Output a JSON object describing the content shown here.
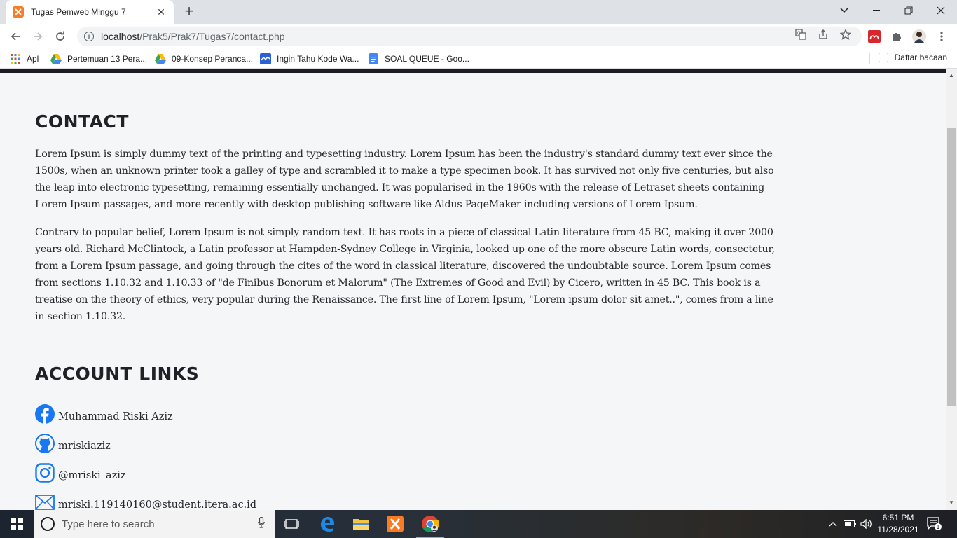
{
  "browser": {
    "tab_title": "Tugas Pemweb Minggu 7",
    "tab_close": "✕",
    "new_tab": "+",
    "url_host": "localhost",
    "url_path": "/Prak5/Prak7/Tugas7/contact.php",
    "bookmarks": [
      {
        "label": "Apl",
        "icon": "apps-grid-icon"
      },
      {
        "label": "Pertemuan 13 Pera...",
        "icon": "google-drive-icon"
      },
      {
        "label": "09-Konsep Peranca...",
        "icon": "google-drive-icon"
      },
      {
        "label": "Ingin Tahu Kode Wa...",
        "icon": "site-icon"
      },
      {
        "label": "SOAL QUEUE - Goo...",
        "icon": "google-docs-icon"
      }
    ],
    "reading_list": "Daftar bacaan"
  },
  "page": {
    "contact_heading": "CONTACT",
    "paragraph_1": "Lorem Ipsum is simply dummy text of the printing and typesetting industry. Lorem Ipsum has been the industry's standard dummy text ever since the 1500s, when an unknown printer took a galley of type and scrambled it to make a type specimen book. It has survived not only five centuries, but also the leap into electronic typesetting, remaining essentially unchanged. It was popularised in the 1960s with the release of Letraset sheets containing Lorem Ipsum passages, and more recently with desktop publishing software like Aldus PageMaker including versions of Lorem Ipsum.",
    "paragraph_2": "Contrary to popular belief, Lorem Ipsum is not simply random text. It has roots in a piece of classical Latin literature from 45 BC, making it over 2000 years old. Richard McClintock, a Latin professor at Hampden-Sydney College in Virginia, looked up one of the more obscure Latin words, consectetur, from a Lorem Ipsum passage, and going through the cites of the word in classical literature, discovered the undoubtable source. Lorem Ipsum comes from sections 1.10.32 and 1.10.33 of \"de Finibus Bonorum et Malorum\" (The Extremes of Good and Evil) by Cicero, written in 45 BC. This book is a treatise on the theory of ethics, very popular during the Renaissance. The first line of Lorem Ipsum, \"Lorem ipsum dolor sit amet..\", comes from a line in section 1.10.32.",
    "account_heading": "ACCOUNT LINKS",
    "accounts": [
      {
        "icon": "facebook-icon",
        "text": "Muhammad Riski Aziz"
      },
      {
        "icon": "github-icon",
        "text": "mriskiaziz"
      },
      {
        "icon": "instagram-icon",
        "text": "@mriski_aziz"
      },
      {
        "icon": "envelope-icon",
        "text": "mriski.119140160@student.itera.ac.id"
      }
    ],
    "icon_color": "#1877f2"
  },
  "taskbar": {
    "search_placeholder": "Type here to search",
    "time": "6:51 PM",
    "date": "11/28/2021",
    "notification_count": "1"
  }
}
